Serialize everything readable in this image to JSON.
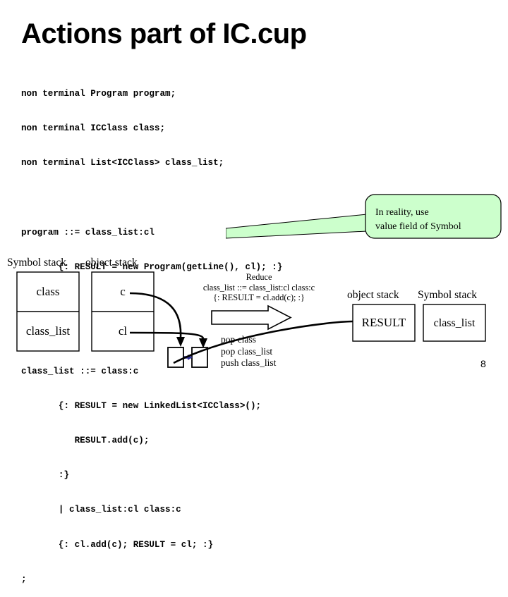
{
  "slide": {
    "title": "Actions part of IC.cup",
    "page_number": "8"
  },
  "code": {
    "lines": [
      "non terminal Program program;",
      "non terminal ICClass class;",
      "non terminal List<ICClass> class_list;",
      "",
      "program ::= class_list:cl",
      "       {: RESULT = new Program(getLine(), cl); :}",
      ";",
      "",
      "class_list ::= class:c",
      "       {: RESULT = new LinkedList<ICClass>();",
      "          RESULT.add(c);",
      "       :}",
      "       | class_list:cl class:c",
      "       {: cl.add(c); RESULT = cl; :}",
      ";"
    ]
  },
  "callout": {
    "fill_color": "#ccffcc",
    "stroke_color": "#000000",
    "lines": [
      "In reality, use",
      "value field of Symbol"
    ]
  },
  "diagram": {
    "left_symbol_stack": {
      "label": "Symbol stack",
      "cells": [
        "class",
        "class_list"
      ]
    },
    "left_object_stack": {
      "label": "object stack",
      "cells": [
        "c",
        "cl"
      ]
    },
    "reduce_note": {
      "lines": [
        "Reduce",
        "class_list ::= class_list:cl class:c",
        "{: RESULT = cl.add(c); :}"
      ]
    },
    "operations": {
      "lines": [
        "pop class",
        "pop class_list",
        "push class_list"
      ]
    },
    "right_object_stack": {
      "label": "object stack",
      "cells": [
        "RESULT"
      ]
    },
    "right_symbol_stack": {
      "label": "Symbol stack",
      "cells": [
        "class_list"
      ]
    },
    "small_box_arrow_color": "#333399"
  }
}
